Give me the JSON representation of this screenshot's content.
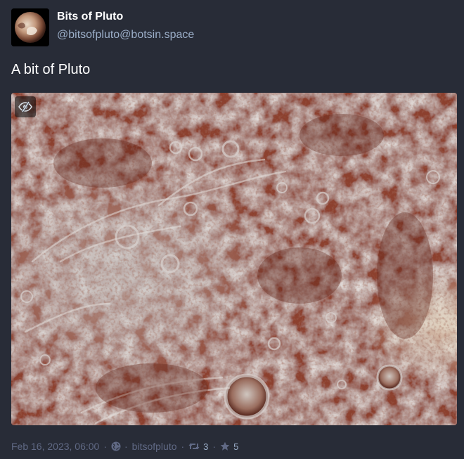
{
  "account": {
    "display_name": "Bits of Pluto",
    "handle": "@bitsofpluto@botsin.space",
    "avatar_icon": "pluto-avatar"
  },
  "status": {
    "text": "A bit of Pluto"
  },
  "media": {
    "description": "pluto-surface-image",
    "hide_icon": "eye-slash-icon"
  },
  "meta": {
    "timestamp": "Feb 16, 2023, 06:00",
    "visibility_icon": "globe-icon",
    "application": "bitsofpluto",
    "boost_icon": "retweet-icon",
    "boosts": "3",
    "favourite_icon": "star-icon",
    "favourites": "5"
  },
  "colors": {
    "background": "#282c37",
    "secondary_text": "#9baec8",
    "dim_text": "#606984"
  }
}
